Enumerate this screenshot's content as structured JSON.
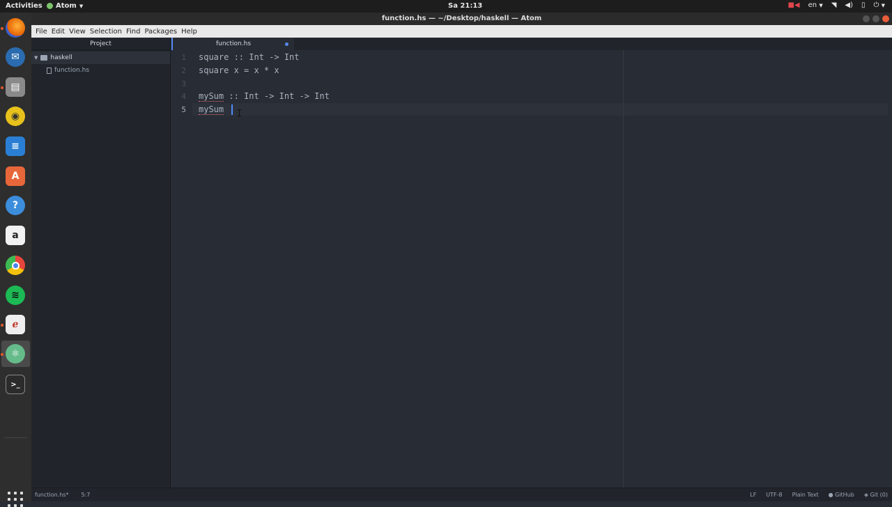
{
  "topbar": {
    "activities": "Activities",
    "app_name": "Atom",
    "clock": "Sa 21:13",
    "keyboard_layout": "en"
  },
  "dock": {
    "items": [
      {
        "icon": "firefox-icon",
        "color": "#e66000"
      },
      {
        "icon": "thunderbird-icon",
        "color": "#2b6cb0"
      },
      {
        "icon": "files-icon",
        "color": "#7a7a7a"
      },
      {
        "icon": "rhythmbox-icon",
        "color": "#e8c21c"
      },
      {
        "icon": "libreoffice-writer-icon",
        "color": "#2a7fd4"
      },
      {
        "icon": "software-center-icon",
        "color": "#e8673a"
      },
      {
        "icon": "help-icon",
        "color": "#3c8ddb"
      },
      {
        "icon": "amazon-icon",
        "color": "#f2f2f2"
      },
      {
        "icon": "chrome-icon",
        "color": "#e8453c"
      },
      {
        "icon": "spotify-icon",
        "color": "#1db954"
      },
      {
        "icon": "document-viewer-icon",
        "color": "#eeeeee"
      },
      {
        "icon": "atom-icon",
        "color": "#66bb8a"
      },
      {
        "icon": "terminal-icon",
        "color": "#2b2b2b"
      }
    ]
  },
  "window": {
    "title": "function.hs — ~/Desktop/haskell — Atom"
  },
  "menu": {
    "items": [
      "File",
      "Edit",
      "View",
      "Selection",
      "Find",
      "Packages",
      "Help"
    ]
  },
  "tree_view": {
    "header": "Project",
    "folder": "haskell",
    "file": "function.hs"
  },
  "tabs": {
    "active": "function.hs"
  },
  "editor": {
    "lines": [
      {
        "number": "1",
        "text": "square :: Int -> Int"
      },
      {
        "number": "2",
        "text": "square x = x * x"
      },
      {
        "number": "3",
        "text": ""
      },
      {
        "number": "4",
        "text": "mySum :: Int -> Int -> Int"
      },
      {
        "number": "5",
        "text": "mySum "
      }
    ]
  },
  "status": {
    "file": "function.hs*",
    "cursor": "5:7",
    "line_ending": "LF",
    "encoding": "UTF-8",
    "grammar": "Plain Text",
    "github": "GitHub",
    "git": "Git (0)"
  }
}
